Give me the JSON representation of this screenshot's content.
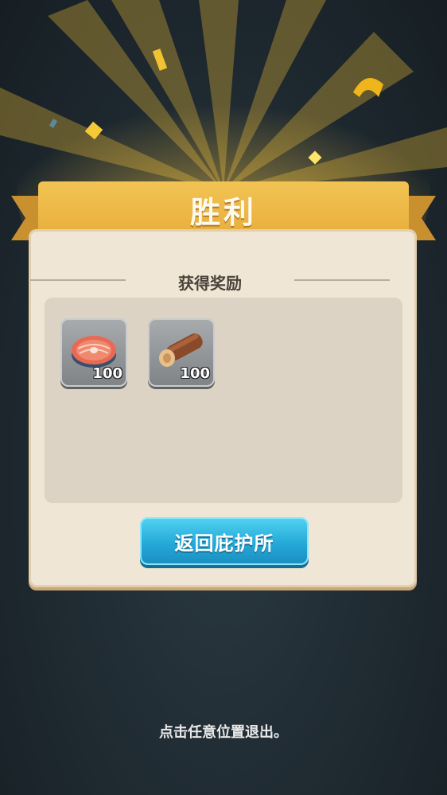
{
  "title": "胜利",
  "subtitle": "获得奖励",
  "rewards": [
    {
      "icon": "salmon-steak-icon",
      "count": "100"
    },
    {
      "icon": "wood-log-icon",
      "count": "100"
    }
  ],
  "return_button": "返回庇护所",
  "exit_hint": "点击任意位置退出。",
  "colors": {
    "ribbon": "#e8ad3b",
    "button": "#24a9d8",
    "panel": "#efe6d6"
  }
}
